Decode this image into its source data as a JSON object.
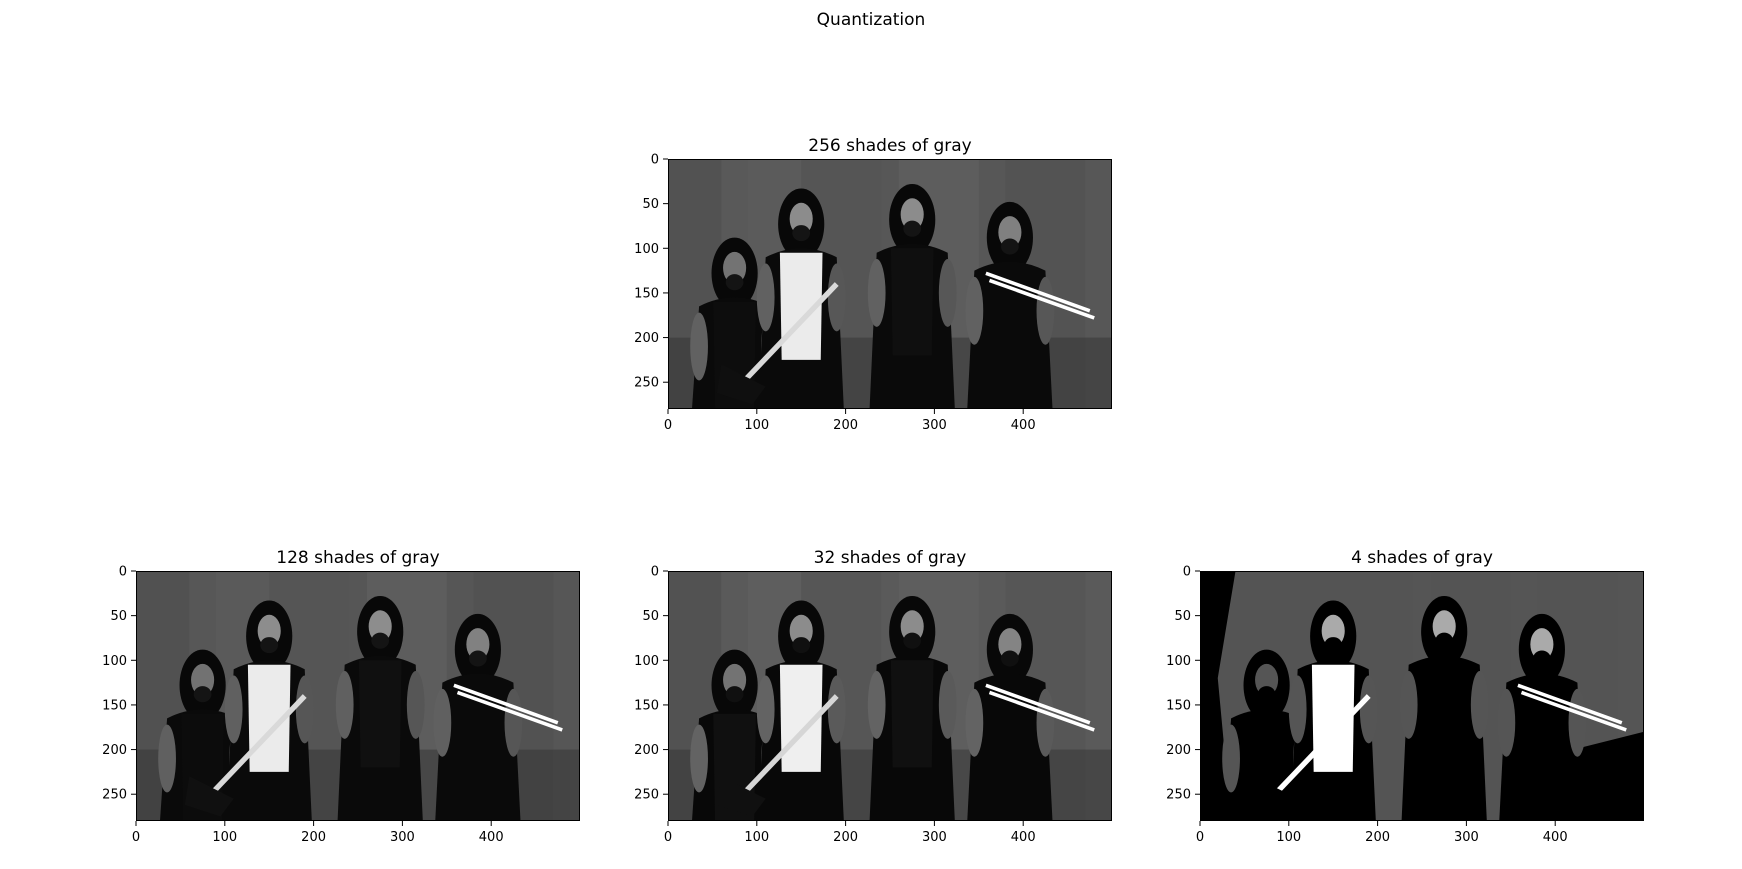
{
  "figure": {
    "suptitle": "Quantization"
  },
  "chart_data": [
    {
      "type": "image",
      "title": "256 shades of gray",
      "levels": 256,
      "image_width": 500,
      "image_height": 280,
      "xlim": [
        0,
        500
      ],
      "ylim": [
        280,
        0
      ],
      "xticks": [
        0,
        100,
        200,
        300,
        400
      ],
      "yticks": [
        0,
        50,
        100,
        150,
        200,
        250
      ],
      "colormap": "gray"
    },
    {
      "type": "image",
      "title": "128 shades of gray",
      "levels": 128,
      "image_width": 500,
      "image_height": 280,
      "xlim": [
        0,
        500
      ],
      "ylim": [
        280,
        0
      ],
      "xticks": [
        0,
        100,
        200,
        300,
        400
      ],
      "yticks": [
        0,
        50,
        100,
        150,
        200,
        250
      ],
      "colormap": "gray"
    },
    {
      "type": "image",
      "title": "32 shades of gray",
      "levels": 32,
      "image_width": 500,
      "image_height": 280,
      "xlim": [
        0,
        500
      ],
      "ylim": [
        280,
        0
      ],
      "xticks": [
        0,
        100,
        200,
        300,
        400
      ],
      "yticks": [
        0,
        50,
        100,
        150,
        200,
        250
      ],
      "colormap": "gray"
    },
    {
      "type": "image",
      "title": "4 shades of gray",
      "levels": 4,
      "image_width": 500,
      "image_height": 280,
      "xlim": [
        0,
        500
      ],
      "ylim": [
        280,
        0
      ],
      "xticks": [
        0,
        100,
        200,
        300,
        400
      ],
      "yticks": [
        0,
        50,
        100,
        150,
        200,
        250
      ],
      "colormap": "gray"
    }
  ]
}
